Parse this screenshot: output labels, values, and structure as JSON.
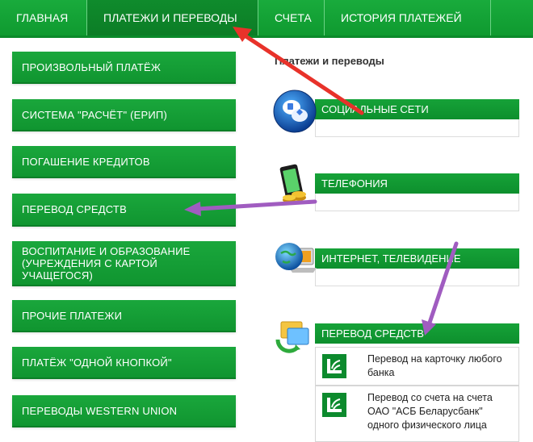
{
  "topnav": {
    "tabs": [
      {
        "label": "Главная"
      },
      {
        "label": "Платежи и переводы",
        "active": true
      },
      {
        "label": "Счета"
      },
      {
        "label": "История платежей"
      }
    ]
  },
  "left_menu": {
    "items": [
      {
        "label": "Произвольный платёж"
      },
      {
        "label": "Система \"Расчёт\" (ЕРИП)"
      },
      {
        "label": "Погашение кредитов"
      },
      {
        "label": "Перевод средств"
      },
      {
        "label": "Воспитание и образование (учреждения с картой учащегося)"
      },
      {
        "label": "Прочие платежи"
      },
      {
        "label": "Платёж \"одной кнопкой\""
      },
      {
        "label": "Переводы Western Union"
      }
    ]
  },
  "main": {
    "title": "Платежи и переводы",
    "categories": [
      {
        "label": "Социальные сети",
        "icon": "social-networks-icon"
      },
      {
        "label": "Телефония",
        "icon": "phone-coins-icon"
      },
      {
        "label": "Интернет, телевидение",
        "icon": "globe-laptop-icon"
      },
      {
        "label": "Перевод средств",
        "icon": "money-transfer-icon"
      }
    ],
    "transfer_options": [
      {
        "label": "Перевод на карточку любого банка",
        "icon": "bank-logo-icon"
      },
      {
        "label": "Перевод со счета на счета ОАО \"АСБ Беларусбанк\" одного физического лица",
        "icon": "bank-logo-icon"
      }
    ]
  },
  "colors": {
    "accent_green": "#13a036",
    "dark_green": "#0c7d26",
    "arrow_red": "#e8322a",
    "arrow_purple": "#a05cc0"
  }
}
